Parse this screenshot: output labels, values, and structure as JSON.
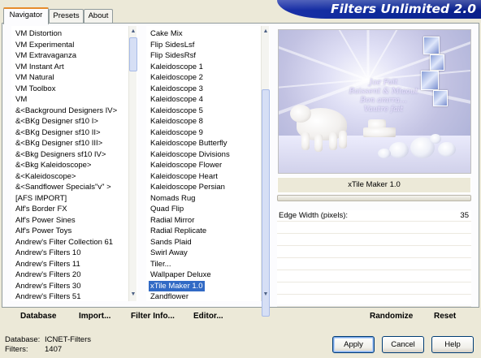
{
  "tabs": [
    {
      "label": "Navigator",
      "active": true
    },
    {
      "label": "Presets",
      "active": false
    },
    {
      "label": "About",
      "active": false
    }
  ],
  "app_title": "Filters Unlimited 2.0",
  "categories": [
    "VM Distortion",
    "VM Experimental",
    "VM Extravaganza",
    "VM Instant Art",
    "VM Natural",
    "VM Toolbox",
    "VM",
    "&<Background Designers IV>",
    "&<BKg Designer sf10 I>",
    "&<BKg Designer sf10 II>",
    "&<BKg Designer sf10 III>",
    "&<Bkg Designers sf10 IV>",
    "&<Bkg Kaleidoscope>",
    "&<Kaleidoscope>",
    "&<Sandflower Specials\"v\" >",
    "[AFS IMPORT]",
    "Alf's Border FX",
    "Alf's Power Sines",
    "Alf's Power Toys",
    "Andrew's Filter Collection 61",
    "Andrew's Filters 10",
    "Andrew's Filters 11",
    "Andrew's Filters 20",
    "Andrew's Filters 30",
    "Andrew's Filters 51"
  ],
  "filters": {
    "items": [
      "Cake Mix",
      "Flip SidesLsf",
      "Flip SidesRsf",
      "Kaleidoscope 1",
      "Kaleidoscope 2",
      "Kaleidoscope 3",
      "Kaleidoscope 4",
      "Kaleidoscope 5",
      "Kaleidoscope 8",
      "Kaleidoscope 9",
      "Kaleidoscope Butterfly",
      "Kaleidoscope Divisions",
      "Kaleidoscope Flower",
      "Kaleidoscope Heart",
      "Kaleidoscope Persian",
      "Nomads Rug",
      "Quad Flip",
      "Radial Mirror",
      "Radial Replicate",
      "Sands Plaid",
      "Swirl Away",
      "Tiler...",
      "Wallpaper Deluxe",
      "xTile Maker 1.0",
      "Zandflower"
    ],
    "selected_index": 23
  },
  "preview_text": [
    "Joe Fait",
    "Baissent & Miaout",
    "Bon amrra...",
    "Vautre fait"
  ],
  "selected_filter_name": "xTile Maker 1.0",
  "params": [
    {
      "label": "Edge Width (pixels):",
      "value": "35"
    }
  ],
  "panel_buttons": {
    "database": "Database",
    "import": "Import...",
    "filter_info": "Filter Info...",
    "editor": "Editor...",
    "randomize": "Randomize",
    "reset": "Reset"
  },
  "status": {
    "database_label": "Database:",
    "database_value": "ICNET-Filters",
    "filters_label": "Filters:",
    "filters_value": "1407"
  },
  "dialog_buttons": {
    "apply": "Apply",
    "cancel": "Cancel",
    "help": "Help"
  }
}
